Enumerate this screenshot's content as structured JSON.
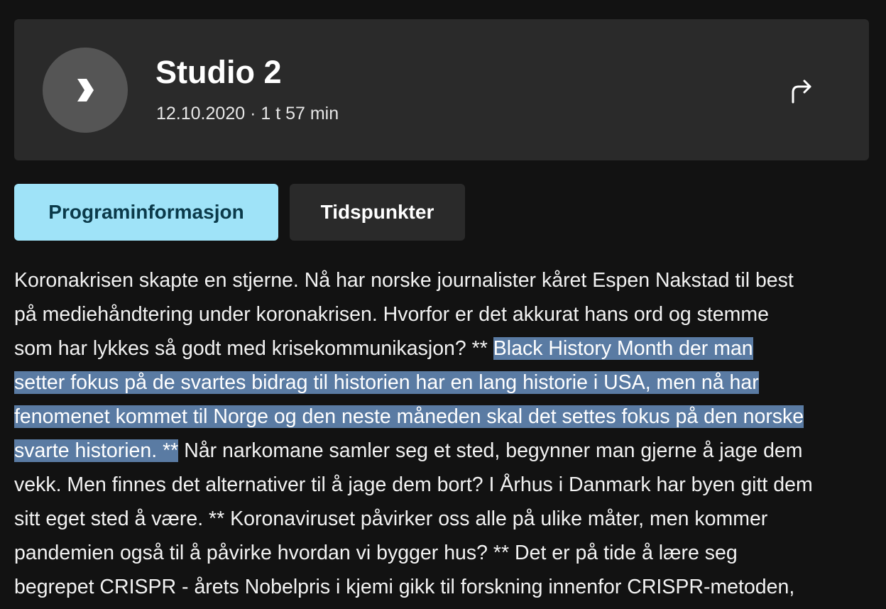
{
  "header": {
    "title": "Studio 2",
    "meta": "12.10.2020 · 1 t 57 min",
    "play_icon": "chevron-right-icon",
    "share_icon": "share-arrow-icon"
  },
  "tabs": [
    {
      "label": "Programinformasjon",
      "active": true
    },
    {
      "label": "Tidspunkter",
      "active": false
    }
  ],
  "description": {
    "lines": [
      {
        "before": "Koronakrisen skapte en stjerne. Nå har norske journalister kåret Espen Nakstad til best",
        "highlight": "",
        "after": ""
      },
      {
        "before": "på mediehåndtering under koronakrisen. Hvorfor er det akkurat hans ord og stemme",
        "highlight": "",
        "after": ""
      },
      {
        "before": "som har lykkes så godt med krisekommunikasjon? ** ",
        "highlight": "Black History Month der man",
        "after": ""
      },
      {
        "before": "",
        "highlight": "setter fokus på de svartes bidrag til historien har en lang historie i USA, men nå har",
        "after": ""
      },
      {
        "before": "",
        "highlight": "fenomenet kommet til Norge og den neste måneden skal det settes fokus på den norske",
        "after": ""
      },
      {
        "before": "",
        "highlight": "svarte historien. **",
        "after": " Når narkomane samler seg et sted, begynner man gjerne å jage dem"
      },
      {
        "before": "vekk. Men finnes det alternativer til å jage dem bort? I Århus i Danmark har byen gitt dem",
        "highlight": "",
        "after": ""
      },
      {
        "before": "sitt eget sted å være. ** Koronaviruset påvirker oss alle på ulike måter, men kommer",
        "highlight": "",
        "after": ""
      },
      {
        "before": "pandemien også til å påvirke hvordan vi bygger hus? ** Det er på tide å lære seg",
        "highlight": "",
        "after": ""
      },
      {
        "before": "begrepet CRISPR - årets Nobelpris i kjemi gikk til forskning innenfor CRISPR-metoden,",
        "highlight": "",
        "after": ""
      }
    ]
  },
  "colors": {
    "background": "#121212",
    "card": "#2a2a2a",
    "tab_active_bg": "#9fe3f8",
    "tab_active_text": "#0b3a4a",
    "selection": "#5a7ba3"
  }
}
